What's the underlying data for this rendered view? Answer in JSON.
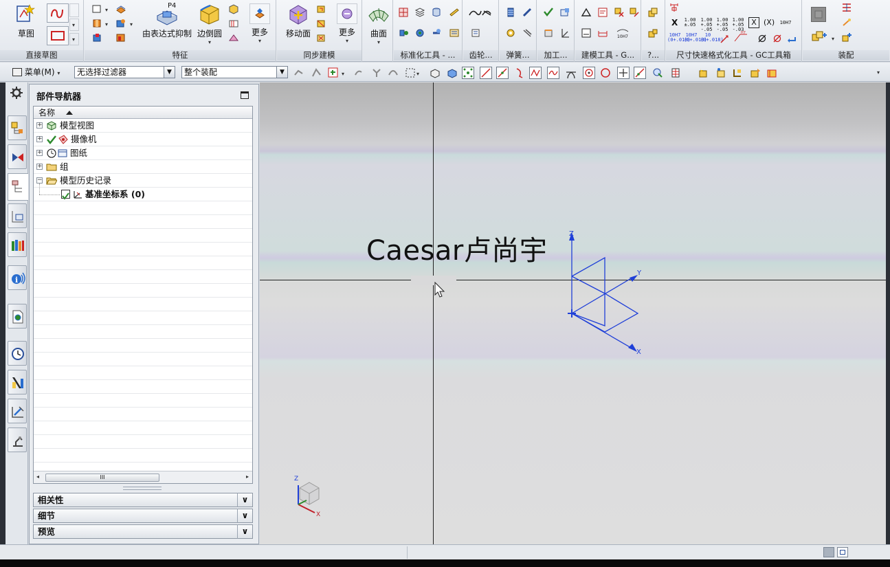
{
  "ribbon": {
    "groups": [
      {
        "label": "直接草图"
      },
      {
        "label": "特征"
      },
      {
        "label": "同步建模"
      },
      {
        "label": "标准化工具 - ..."
      },
      {
        "label": "齿轮..."
      },
      {
        "label": "弹簧..."
      },
      {
        "label": "加工..."
      },
      {
        "label": "建模工具 - G..."
      },
      {
        "label": "?..."
      },
      {
        "label": "尺寸快速格式化工具 - GC工具箱"
      },
      {
        "label": "装配"
      }
    ],
    "buttons": {
      "sketch": "草图",
      "expression_extrude": "由表达式抑制",
      "expression_extrude_badge": "P4",
      "edge_blend": "边倒圆",
      "more_feature": "更多",
      "move_face": "移动面",
      "more_sync": "更多",
      "surface": "曲面"
    },
    "dim_tools": {
      "x_label": "X",
      "tol_1": "1.00\n±.05",
      "tol_2": "1.00\n+.05\n-.05",
      "tol_3": "1.00\n+.05\n-.05",
      "tol_4": "1.00\n+.05\n-.03",
      "box_x": "X",
      "paren_x": "(X)",
      "fit_1": "10H7",
      "fit_2": "10H7\n(0+.018)",
      "fit_3": "10H7\n(0+.018)",
      "fit_4": "10\n(0+.018)",
      "fit_5": "10H7"
    }
  },
  "toolbar": {
    "menu_label": "菜单(M)",
    "filter_value": "无选择过滤器",
    "scope_value": "整个装配"
  },
  "navigator": {
    "title": "部件导航器",
    "column_name": "名称",
    "items": [
      {
        "label": "模型视图"
      },
      {
        "label": "摄像机"
      },
      {
        "label": "图纸"
      },
      {
        "label": "组"
      },
      {
        "label": "模型历史记录"
      },
      {
        "label": "基准坐标系 (0)"
      }
    ],
    "panels": [
      {
        "label": "相关性"
      },
      {
        "label": "细节"
      },
      {
        "label": "预览"
      }
    ],
    "scroll_grip": "III"
  },
  "viewport": {
    "watermark_text": "Caesar卢尚宇",
    "csys_labels": {
      "z": "Z",
      "y": "Y",
      "x": "X"
    },
    "triad_labels": {
      "z": "Z",
      "x": "X"
    }
  },
  "colors": {
    "csys_blue": "#1f3fd8",
    "triad_red": "#c0202a",
    "accent": "#2a6ecf"
  }
}
